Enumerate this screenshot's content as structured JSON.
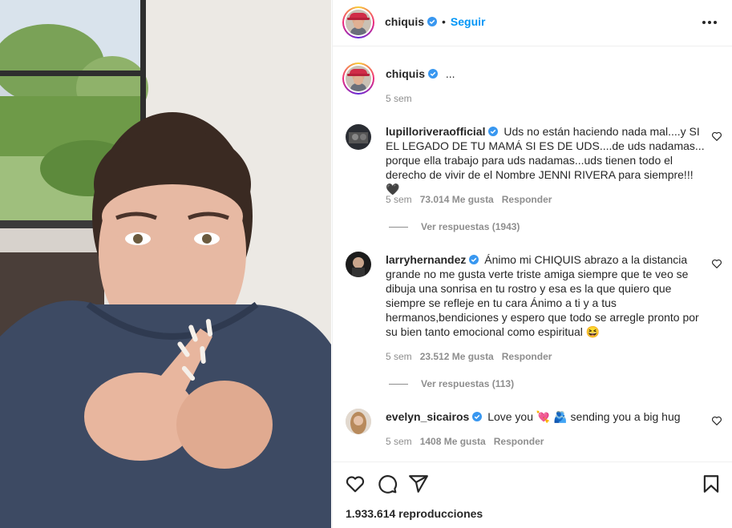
{
  "post": {
    "username": "chiquis",
    "follow_label": "Seguir",
    "caption_text": "...",
    "caption_time": "5 sem"
  },
  "comments": [
    {
      "username": "lupilloriveraofficial",
      "text": "Uds no están haciendo nada mal....y SI EL LEGADO DE TU MAMÁ SI ES DE UDS....de uds nadamas... porque ella trabajo para uds nadamas...uds tienen todo el derecho de vivir de el Nombre JENNI RIVERA para siempre!!!🖤",
      "time": "5 sem",
      "likes": "73.014 Me gusta",
      "reply": "Responder",
      "view_replies": "Ver respuestas (1943)"
    },
    {
      "username": "larryhernandez",
      "text": "Ánimo mi CHIQUIS abrazo a la distancia grande no me gusta verte triste amiga siempre que te veo se dibuja una sonrisa en tu rostro y esa es la que quiero que siempre se refleje en tu cara Ánimo a ti y a tus hermanos,bendiciones y espero que todo se arregle pronto por su bien tanto emocional como espiritual 😆",
      "time": "5 sem",
      "likes": "23.512 Me gusta",
      "reply": "Responder",
      "view_replies": "Ver respuestas (113)"
    },
    {
      "username": "evelyn_sicairos",
      "text": "Love you 💘 🫂 sending you a big hug",
      "time": "5 sem",
      "likes": "1408 Me gusta",
      "reply": "Responder"
    }
  ],
  "footer": {
    "views": "1.933.614 reproducciones"
  },
  "icons": {
    "like": "heart-icon",
    "comment": "comment-icon",
    "share": "share-icon",
    "save": "bookmark-icon",
    "more": "more-icon",
    "verified": "verified-icon"
  },
  "colors": {
    "accent": "#0095f6",
    "verified": "#3897f0",
    "muted": "#8e8e8e",
    "text": "#262626"
  }
}
